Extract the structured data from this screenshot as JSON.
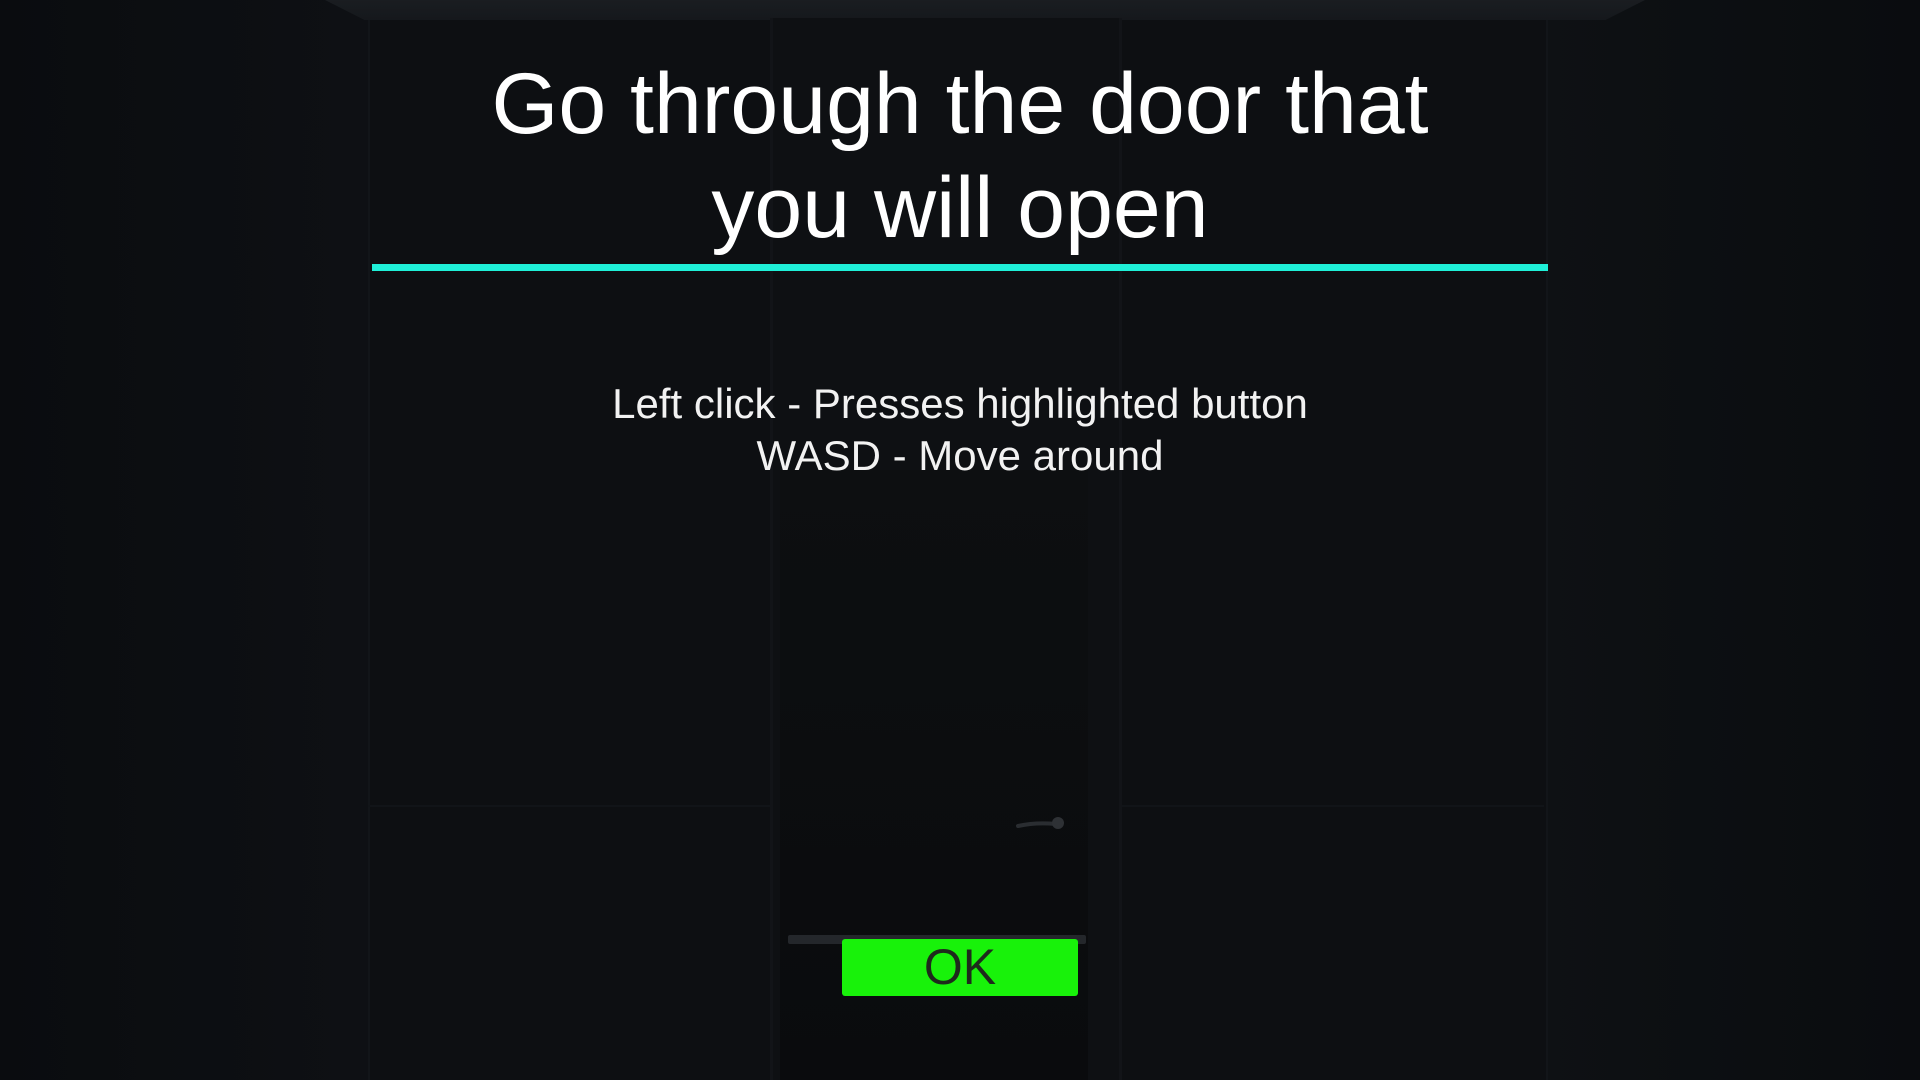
{
  "dialog": {
    "title_line_1": "Go through the door that",
    "title_line_2": "you will open",
    "instructions": [
      "Left click - Presses highlighted button",
      "WASD - Move around"
    ],
    "ok_label": "OK"
  },
  "colors": {
    "accent_underline": "#1ff0d8",
    "ok_button": "#18f20a",
    "background": "#0c0e11"
  },
  "scene": {
    "icons": [
      "door-handle-icon"
    ]
  }
}
